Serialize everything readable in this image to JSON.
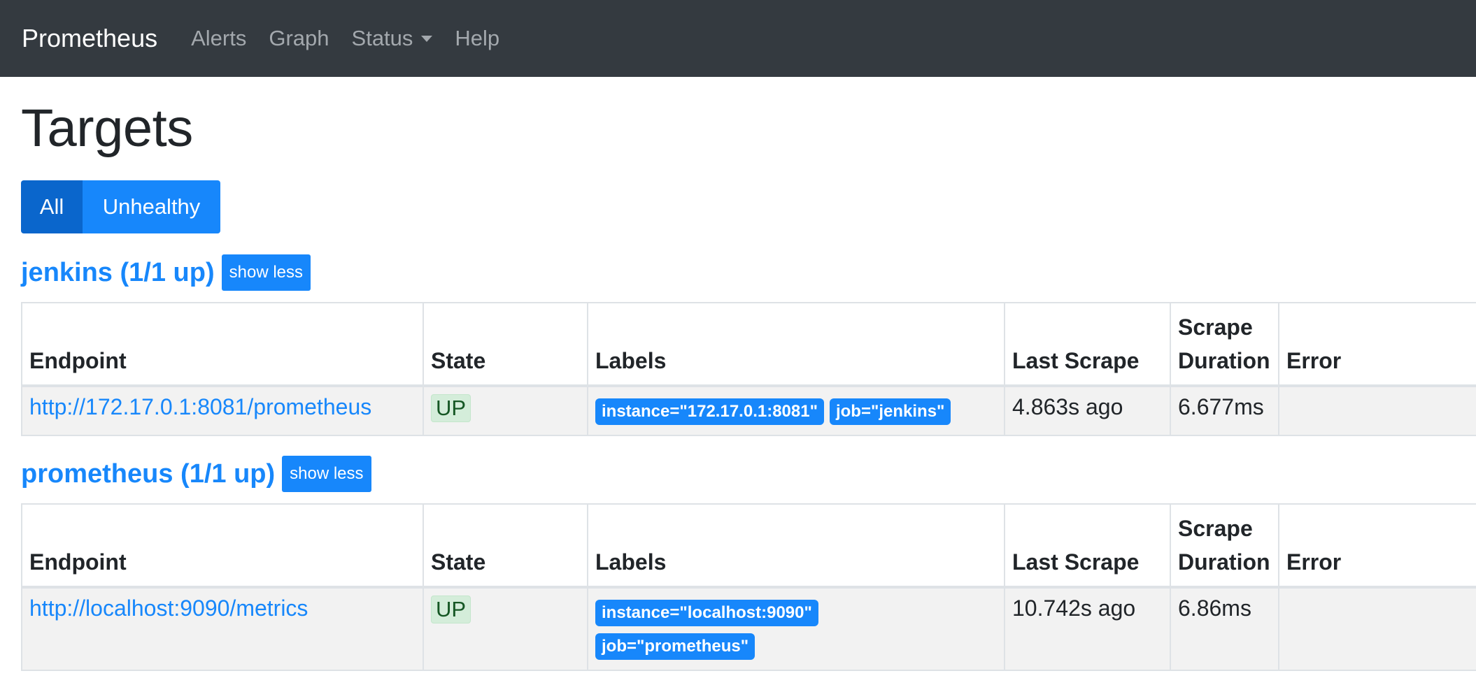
{
  "navbar": {
    "brand": "Prometheus",
    "links": [
      {
        "label": "Alerts"
      },
      {
        "label": "Graph"
      },
      {
        "label": "Status"
      },
      {
        "label": "Help"
      }
    ]
  },
  "page": {
    "title": "Targets",
    "filters": [
      {
        "label": "All"
      },
      {
        "label": "Unhealthy"
      }
    ]
  },
  "columns": {
    "endpoint": "Endpoint",
    "state": "State",
    "labels": "Labels",
    "last_scrape": "Last Scrape",
    "scrape_duration": "Scrape Duration",
    "error": "Error"
  },
  "jobs": [
    {
      "title": "jenkins (1/1 up)",
      "toggle": "show less",
      "rows": [
        {
          "endpoint": "http://172.17.0.1:8081/prometheus",
          "state": "UP",
          "labels": [
            "instance=\"172.17.0.1:8081\"",
            "job=\"jenkins\""
          ],
          "last_scrape": "4.863s ago",
          "duration": "6.677ms",
          "error": ""
        }
      ]
    },
    {
      "title": "prometheus (1/1 up)",
      "toggle": "show less",
      "rows": [
        {
          "endpoint": "http://localhost:9090/metrics",
          "state": "UP",
          "labels": [
            "instance=\"localhost:9090\"",
            "job=\"prometheus\""
          ],
          "last_scrape": "10.742s ago",
          "duration": "6.86ms",
          "error": ""
        }
      ]
    }
  ],
  "colors": {
    "navbar": "#343a40",
    "primary": "#1787fb",
    "primary_active": "#0a66cc",
    "up_bg": "#d4edda",
    "up_text": "#155724"
  }
}
